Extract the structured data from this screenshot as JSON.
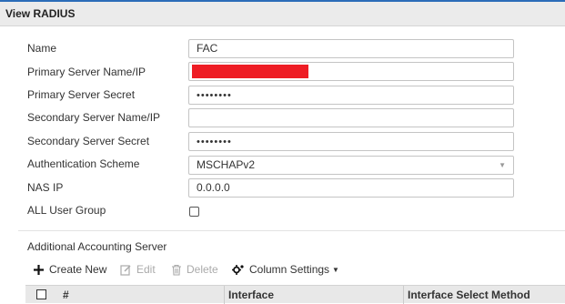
{
  "header": {
    "title": "View RADIUS"
  },
  "form": {
    "name": {
      "label": "Name",
      "value": "FAC"
    },
    "primary_server": {
      "label": "Primary Server Name/IP",
      "value": ""
    },
    "primary_secret": {
      "label": "Primary Server Secret",
      "value": "••••••••"
    },
    "secondary_server": {
      "label": "Secondary Server Name/IP",
      "value": ""
    },
    "secondary_secret": {
      "label": "Secondary Server Secret",
      "value": "••••••••"
    },
    "auth_scheme": {
      "label": "Authentication Scheme",
      "value": "MSCHAPv2"
    },
    "nas_ip": {
      "label": "NAS IP",
      "value": "0.0.0.0"
    },
    "all_user_group": {
      "label": "ALL User Group",
      "checked": false
    }
  },
  "accounting": {
    "title": "Additional Accounting Server",
    "toolbar": {
      "create_new": "Create New",
      "edit": "Edit",
      "delete": "Delete",
      "column_settings": "Column Settings"
    },
    "table": {
      "columns": [
        "#",
        "Interface",
        "Interface Select Method"
      ]
    }
  },
  "colors": {
    "accent": "#2b6cb8",
    "redaction": "#ee1c24",
    "header_bg": "#ebebeb"
  }
}
